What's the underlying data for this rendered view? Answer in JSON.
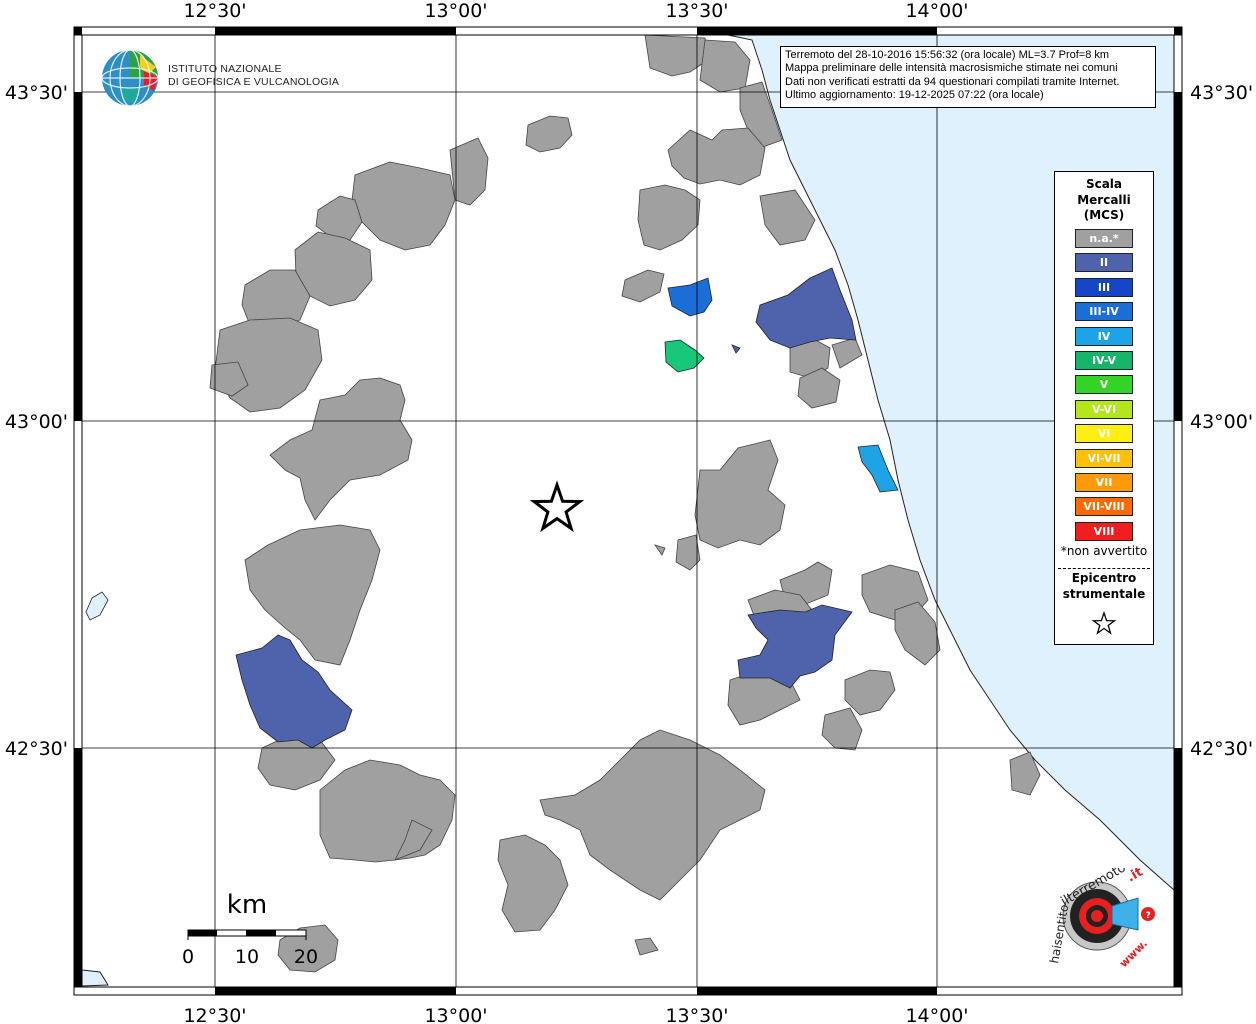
{
  "info": {
    "line1": "Terremoto del 28-10-2016 15:56:32 (ora locale) ML=3.7 Prof=8 km",
    "line2": "Mappa preliminare delle intensità macrosismiche stimate nei comuni",
    "line3": "Dati non verificati estratti da 94 questionari compilati tramite Internet.",
    "line4": "Ultimo aggiornamento: 19-12-2025 07:22 (ora locale)"
  },
  "axes": {
    "top": [
      "12°30'",
      "13°00'",
      "13°30'",
      "14°00'"
    ],
    "bottom": [
      "12°30'",
      "13°00'",
      "13°30'",
      "14°00'"
    ],
    "left": [
      "43°30'",
      "43°00'",
      "42°30'"
    ],
    "right": [
      "43°30'",
      "43°00'",
      "42°30'"
    ]
  },
  "legend": {
    "title_line1": "Scala",
    "title_line2": "Mercalli",
    "title_line3": "(MCS)",
    "items": [
      {
        "label": "n.a.*",
        "color": "#a0a0a0"
      },
      {
        "label": "II",
        "color": "#4f63ac"
      },
      {
        "label": "III",
        "color": "#1546c8"
      },
      {
        "label": "III-IV",
        "color": "#1a6ed6"
      },
      {
        "label": "IV",
        "color": "#1ea4e6"
      },
      {
        "label": "IV-V",
        "color": "#18b46a"
      },
      {
        "label": "V",
        "color": "#34d426"
      },
      {
        "label": "V-VI",
        "color": "#b4e61e"
      },
      {
        "label": "VI",
        "color": "#ffee14"
      },
      {
        "label": "VI-VII",
        "color": "#ffc00a"
      },
      {
        "label": "VII",
        "color": "#ff9a0a"
      },
      {
        "label": "VII-VIII",
        "color": "#ff6a00"
      },
      {
        "label": "VIII",
        "color": "#f01e1e"
      }
    ],
    "note": "*non avvertito",
    "epicenter_line1": "Epicentro",
    "epicenter_line2": "strumentale"
  },
  "scale": {
    "unit": "km",
    "labels": [
      "0",
      "10",
      "20"
    ]
  },
  "logo": {
    "line1": "ISTITUTO NAZIONALE",
    "line2": "DI GEOFISICA E VULCANOLOGIA"
  },
  "hs_logo": {
    "text1": "www.",
    "text2": "haisentito",
    "text3": "ilterremoto",
    "text4": ".it"
  },
  "colors": {
    "sea": "#dff1fd",
    "na": "#a0a0a0",
    "II": "#4f63ac",
    "III_IV": "#1a6ed6",
    "IV": "#1ea4e6",
    "IV_V": "#18c87a"
  }
}
